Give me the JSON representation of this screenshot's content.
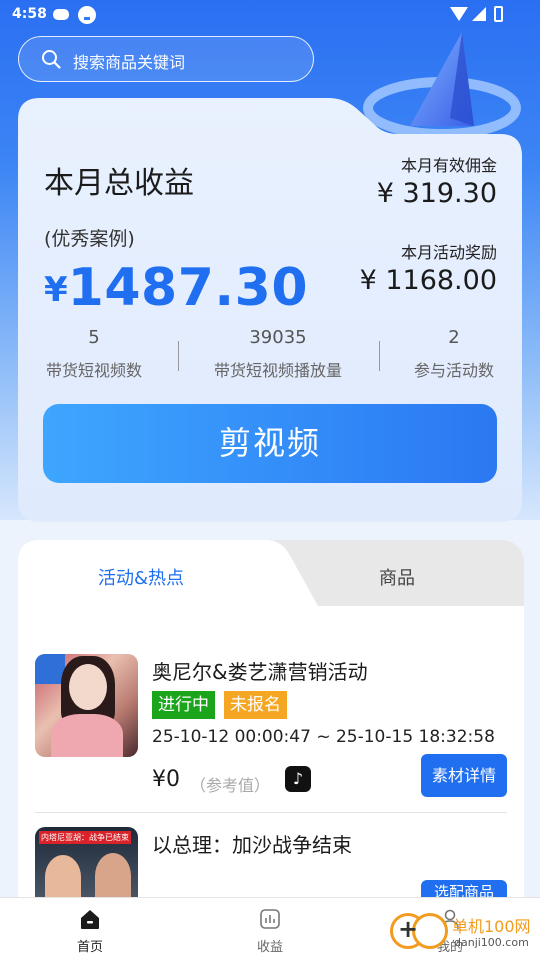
{
  "status_bar": {
    "time": "4:58"
  },
  "search": {
    "placeholder": "搜索商品关键词"
  },
  "earnings": {
    "title": "本月总收益",
    "subtitle": "(优秀案例)",
    "currency": "¥",
    "total": "1487.30",
    "commission_label": "本月有效佣金",
    "commission_value": "¥ 319.30",
    "bonus_label": "本月活动奖励",
    "bonus_value": "¥ 1168.00"
  },
  "stats": [
    {
      "value": "5",
      "label": "带货短视频数"
    },
    {
      "value": "39035",
      "label": "带货短视频播放量"
    },
    {
      "value": "2",
      "label": "参与活动数"
    }
  ],
  "cut_button": "剪视频",
  "tabs": [
    {
      "label": "活动&热点",
      "active": true
    },
    {
      "label": "商品",
      "active": false
    }
  ],
  "items": [
    {
      "title": "奥尼尔&娄艺潇营销活动",
      "badges": [
        "进行中",
        "未报名"
      ],
      "time": "25-10-12 00:00:47 ~ 25-10-15 18:32:58",
      "price": "¥0",
      "price_note": "（参考值）",
      "platform_icon": "tiktok-icon",
      "button": "素材详情"
    },
    {
      "title": "以总理：加沙战争结束",
      "thumb_caption": "内塔尼亚胡：战争已结束",
      "button": "选配商品"
    }
  ],
  "bottom_nav": [
    {
      "label": "首页",
      "icon": "home-icon",
      "active": true
    },
    {
      "label": "收益",
      "icon": "chart-icon",
      "active": false
    },
    {
      "label": "我的",
      "icon": "user-icon",
      "active": false
    }
  ],
  "watermark": {
    "brand": "单机100网",
    "url": "danji100.com"
  },
  "colors": {
    "accent": "#1f6ff0",
    "green": "#1aa51a",
    "orange": "#f5a623"
  }
}
